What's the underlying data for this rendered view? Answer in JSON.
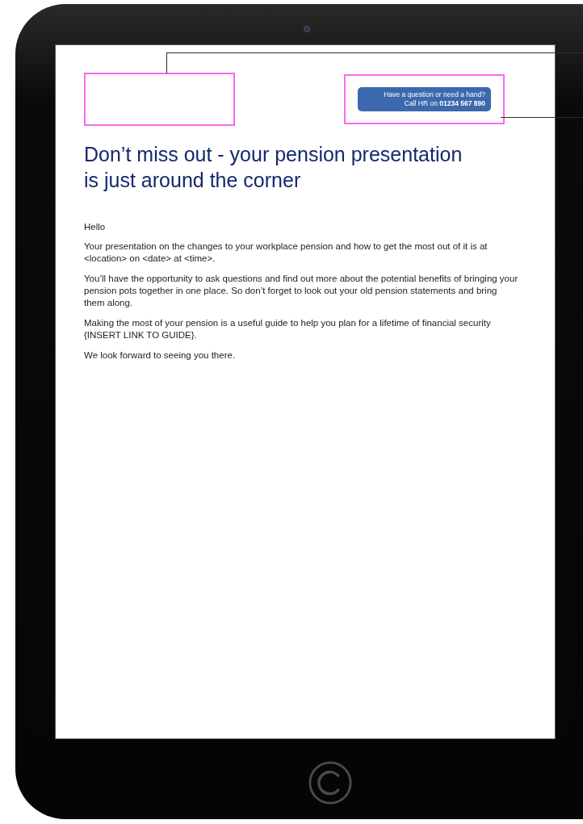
{
  "header": {
    "help_lines": [
      "Have a question or need a hand?",
      "Call HR on **01234 567 890**"
    ]
  },
  "title": "Don’t miss out - your pension presentation is just around the corner",
  "paragraphs": [
    "Hello",
    "Your presentation on the changes to your workplace pension and how to get the most out of it is at <location> on <date> at <time>.",
    "You’ll have the opportunity to ask questions and find out more about the potential benefits of bringing your pension pots together in one place. So don’t forget to look out your old pension statements and bring them along.",
    "Making the most of your pension is a useful guide to help you plan for a lifetime of financial security {INSERT LINK TO GUIDE}.",
    "We look forward to seeing you there."
  ]
}
